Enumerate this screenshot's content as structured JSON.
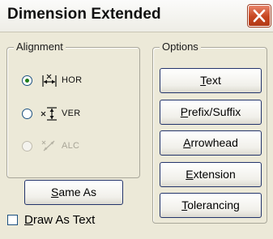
{
  "window": {
    "title": "Dimension Extended",
    "close_icon": "close-icon"
  },
  "alignment": {
    "legend": "Alignment",
    "options": [
      {
        "id": "hor",
        "label": "HOR",
        "icon": "horizontal-dimension-icon",
        "checked": true,
        "enabled": true
      },
      {
        "id": "ver",
        "label": "VER",
        "icon": "vertical-dimension-icon",
        "checked": false,
        "enabled": true
      },
      {
        "id": "alc",
        "label": "ALC",
        "icon": "aligned-dimension-icon",
        "checked": false,
        "enabled": false
      }
    ]
  },
  "same_as": {
    "mnemonic": "S",
    "rest": "ame As"
  },
  "draw_as_text": {
    "mnemonic": "D",
    "rest": "raw As Text",
    "checked": false
  },
  "options": {
    "legend": "Options",
    "buttons": [
      {
        "id": "text",
        "mnemonic": "T",
        "rest": "ext"
      },
      {
        "id": "prefix-suffix",
        "mnemonic": "P",
        "rest": "refix/Suffix"
      },
      {
        "id": "arrowhead",
        "mnemonic": "A",
        "rest": "rrowhead"
      },
      {
        "id": "extension",
        "mnemonic": "E",
        "rest": "xtension"
      },
      {
        "id": "tolerancing",
        "mnemonic": "T",
        "rest": "olerancing"
      }
    ]
  },
  "colors": {
    "dialog_background": "#ece9d8",
    "close_button": "#c6451f",
    "radio_selected": "#1f7d1a",
    "button_border": "#23346b"
  }
}
